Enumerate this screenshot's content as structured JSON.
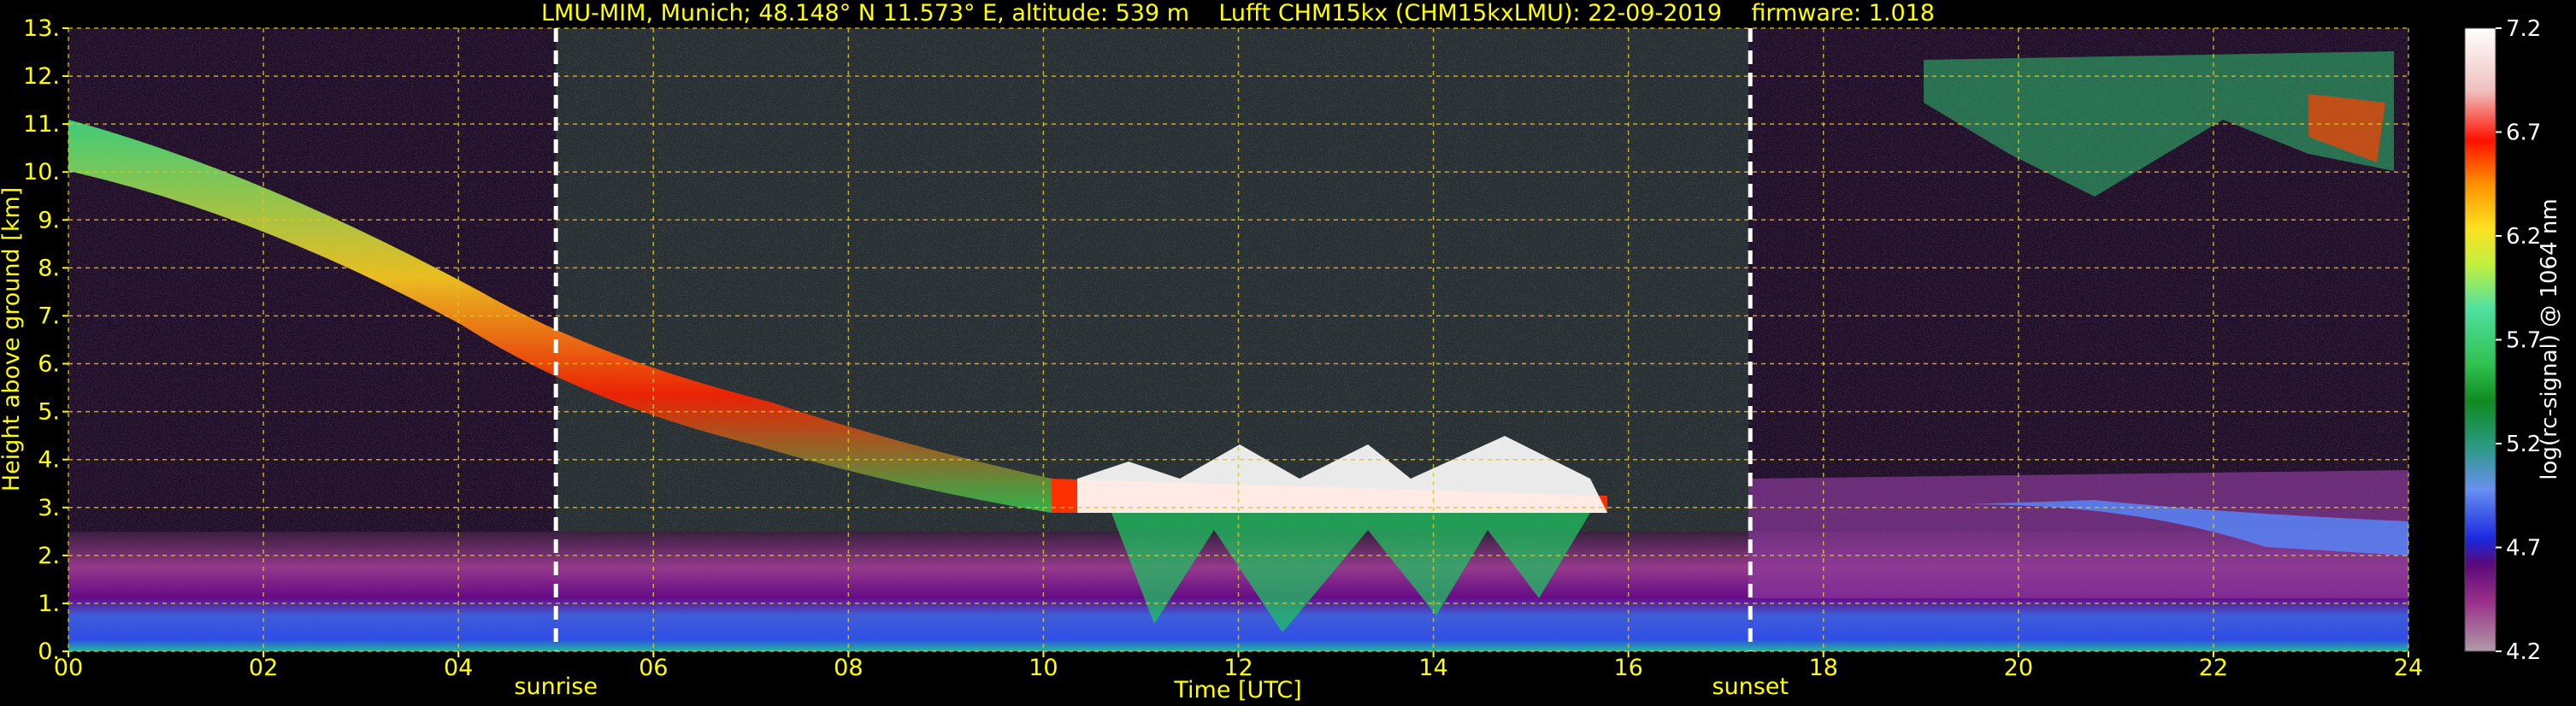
{
  "chart_data": {
    "type": "heatmap",
    "title": "LMU-MIM, Munich; 48.148° N 11.573° E, altitude: 539 m    Lufft CHM15kx (CHM15kxLMU): 22-09-2019    firmware: 1.018",
    "xlabel": "Time [UTC]",
    "ylabel": "Height above ground [km]",
    "xlim": [
      0,
      24
    ],
    "ylim": [
      0,
      13
    ],
    "x_ticks": [
      "00",
      "02",
      "04",
      "06",
      "08",
      "10",
      "12",
      "14",
      "16",
      "18",
      "20",
      "22",
      "24"
    ],
    "y_ticks": [
      "0.",
      "1.",
      "2.",
      "3.",
      "4.",
      "5.",
      "6.",
      "7.",
      "8.",
      "9.",
      "10.",
      "11.",
      "12.",
      "13."
    ],
    "grid": true,
    "markers": [
      {
        "label": "sunrise",
        "time": 5.0
      },
      {
        "label": "sunset",
        "time": 17.25
      }
    ],
    "colorbar": {
      "label": "log(rc-signal) @ 1064 nm",
      "ticks": [
        "4.2",
        "4.7",
        "5.2",
        "5.7",
        "6.2",
        "6.7",
        "7.2"
      ],
      "range": [
        4.2,
        7.2
      ]
    },
    "layers": [
      {
        "name": "cirrus",
        "points": [
          [
            0,
            10.4
          ],
          [
            1.5,
            9.2
          ],
          [
            3.5,
            7.8
          ],
          [
            5.5,
            6.2
          ],
          [
            7.5,
            5.0
          ],
          [
            9.5,
            3.8
          ],
          [
            11,
            3.1
          ],
          [
            13,
            3.1
          ],
          [
            15.5,
            3.2
          ]
        ]
      },
      {
        "name": "cloud-base",
        "height": 3.0,
        "from": 10.5,
        "to": 16.0
      },
      {
        "name": "upper-clouds",
        "height": 10.8,
        "from": 18.5,
        "to": 23.8
      },
      {
        "name": "boundary-layer",
        "top": 2.4,
        "from": 0,
        "to": 24
      }
    ]
  }
}
